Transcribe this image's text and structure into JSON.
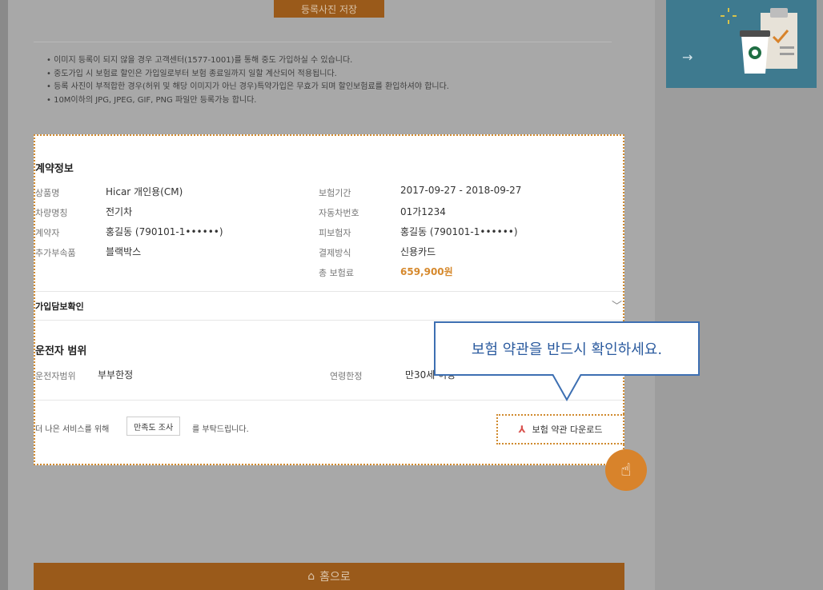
{
  "top": {
    "save_photo_label": "등록사진 저장"
  },
  "notes": [
    "• 이미지 등록이 되지 않을 경우 고객센터(1577-1001)를 통해 중도 가입하실 수 있습니다.",
    "• 중도가입 시 보험료 할인은 가입일로부터 보험 종료일까지 일할 계산되어 적용됩니다.",
    "• 등록 사진이 부적합한 경우(허위 및 해당 이미지가 아닌 경우)특약가입은 무효가 되며 할인보험료를 환입하셔야 합니다.",
    "• 10M이하의 JPG, JPEG, GIF, PNG 파일만 등록가능 합니다."
  ],
  "contract": {
    "title": "계약정보",
    "left": [
      {
        "label": "상품명",
        "value": "Hicar 개인용(CM)"
      },
      {
        "label": "차량명칭",
        "value": "전기차"
      },
      {
        "label": "계약자",
        "value": "홍길동 (790101-1••••••)"
      },
      {
        "label": "추가부속품",
        "value": "블랙박스"
      }
    ],
    "right": [
      {
        "label": "보험기간",
        "value": "2017-09-27 - 2018-09-27"
      },
      {
        "label": "자동차번호",
        "value": "01가1234"
      },
      {
        "label": "피보험자",
        "value": "홍길동 (790101-1••••••)"
      },
      {
        "label": "결제방식",
        "value": "신용카드"
      },
      {
        "label": "총 보험료",
        "value": "659,900원"
      }
    ]
  },
  "coverage": {
    "title": "가입담보확인"
  },
  "driver": {
    "title": "운전자 범위",
    "range_label": "운전자범위",
    "range_value": "부부한정",
    "age_label": "연령한정",
    "age_value": "만30세 이상"
  },
  "survey": {
    "prefix": "더 나은 서비스를 위해",
    "button": "만족도 조사",
    "suffix": "를 부탁드립니다."
  },
  "download": {
    "label": "보험 약관 다운로드"
  },
  "tooltip": {
    "text": "보험 약관을 반드시 확인하세요."
  },
  "home": {
    "label": "홈으로"
  },
  "colors": {
    "accent": "#d6892d",
    "brown": "#9a5a1a",
    "tooltip_blue": "#3d6fb2"
  }
}
